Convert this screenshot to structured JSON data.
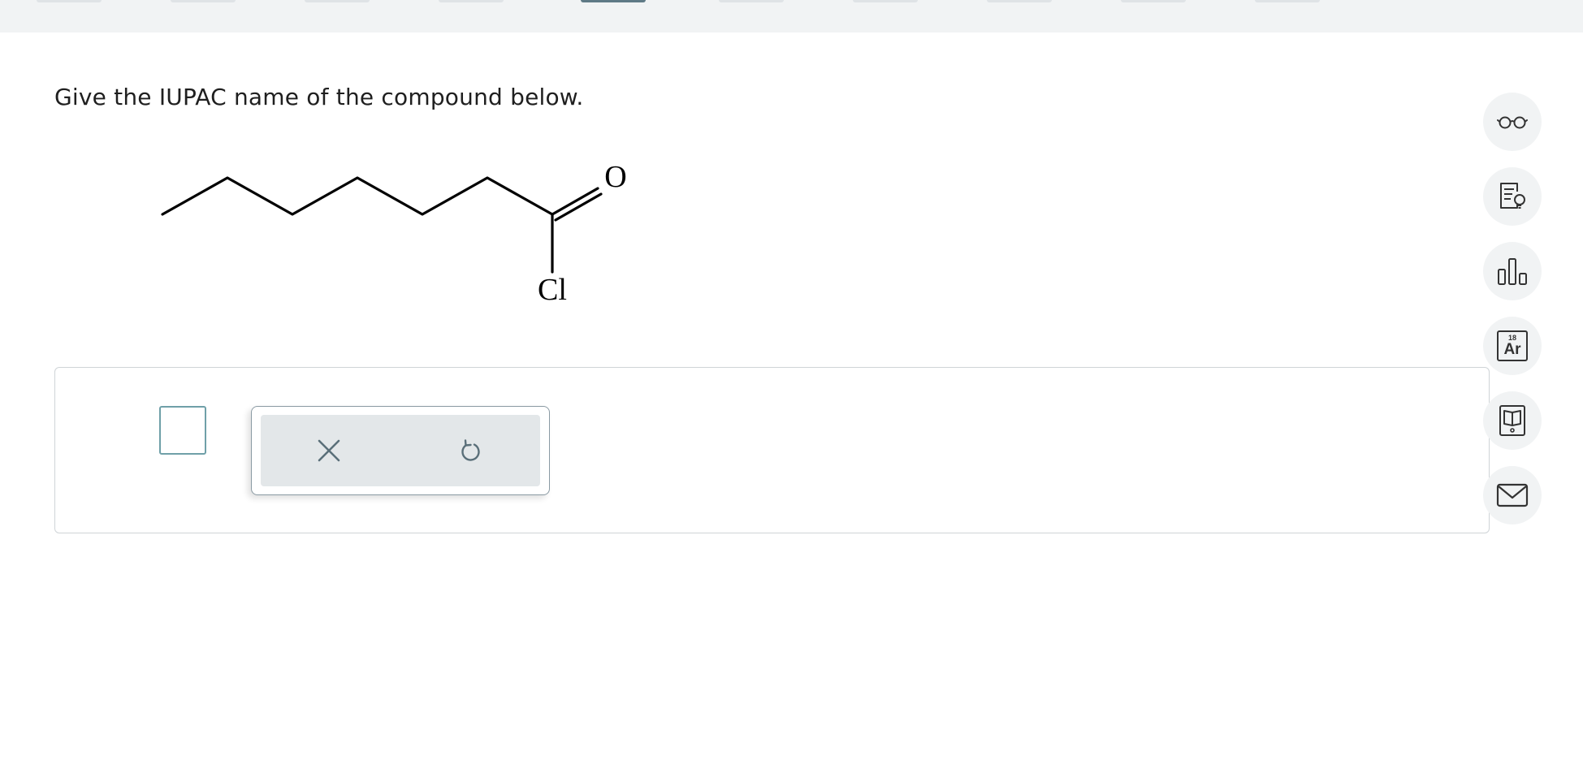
{
  "question": {
    "prompt": "Give the IUPAC name of the compound below."
  },
  "structure": {
    "atom_labels": {
      "oxygen": "O",
      "chlorine": "Cl"
    }
  },
  "answer": {
    "value": ""
  },
  "tools": {
    "clear_icon": "x-icon",
    "undo_icon": "undo-icon"
  },
  "sidebar": {
    "items": [
      {
        "icon": "glasses-icon"
      },
      {
        "icon": "lightbulb-notes-icon"
      },
      {
        "icon": "bar-chart-icon"
      },
      {
        "icon": "periodic-table-icon",
        "atomic_number": "18",
        "symbol": "Ar"
      },
      {
        "icon": "textbook-icon"
      },
      {
        "icon": "mail-icon"
      }
    ]
  },
  "colors": {
    "topbar": "#f1f3f4",
    "answer_border": "#6fa0a8",
    "tool_icon": "#5a6f79",
    "side_button": "#f1f3f4"
  }
}
